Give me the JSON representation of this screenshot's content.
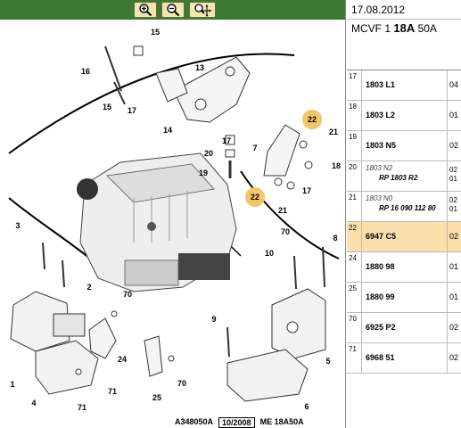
{
  "toolbar": {
    "zoom_in_icon": "zoom-in-icon",
    "zoom_out_icon": "zoom-out-icon",
    "pan_zoom_icon": "pan-zoom-icon"
  },
  "diagram": {
    "callouts": [
      "15",
      "16",
      "13",
      "15",
      "17",
      "14",
      "22",
      "21",
      "17",
      "20",
      "19",
      "7",
      "18",
      "17",
      "22",
      "21",
      "3",
      "2",
      "10",
      "8",
      "70",
      "70",
      "9",
      "24",
      "1",
      "4",
      "71",
      "71",
      "25",
      "70",
      "5",
      "6"
    ],
    "footer": {
      "ref_code": "A348050A",
      "date_box": "10/2008",
      "model_ref": "ME 18A50A"
    }
  },
  "header": {
    "date": "17.08.2012",
    "model_prefix": "MCVF 1",
    "model_bold": "18A",
    "model_suffix": "50A"
  },
  "parts": [
    {
      "num": "17",
      "ref": "1803 L1",
      "qty": "04"
    },
    {
      "num": "18",
      "ref": "1803 L2",
      "qty": "01"
    },
    {
      "num": "19",
      "ref": "1803 N5",
      "qty": "02"
    },
    {
      "num": "20",
      "ref": "1803 N2",
      "altref": "RP 1803 R2",
      "qty1": "02",
      "qty2": "01"
    },
    {
      "num": "21",
      "ref": "1803 N0",
      "altref": "RP 16 090 112 80",
      "qty1": "02",
      "qty2": "01"
    },
    {
      "num": "22",
      "ref": "6947 C5",
      "qty": "02",
      "selected": true
    },
    {
      "num": "24",
      "ref": "1880 98",
      "qty": "01"
    },
    {
      "num": "25",
      "ref": "1880 99",
      "qty": "01"
    },
    {
      "num": "70",
      "ref": "6925 P2",
      "qty": "02"
    },
    {
      "num": "71",
      "ref": "6968 51",
      "qty": "02"
    }
  ],
  "colors": {
    "toolbar": "#3c7a34",
    "tool_button": "#f2e6b0",
    "highlight": "#f5c56a",
    "selected_row": "#fbe0ae"
  }
}
